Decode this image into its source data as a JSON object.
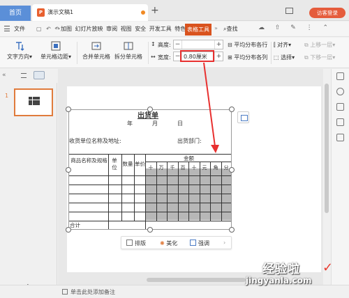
{
  "titlebar": {
    "home_tab": "首页",
    "doc_tab": "演示文稿1",
    "new_tab": "+",
    "guest_login": "访客登录"
  },
  "menubar": {
    "file": "文件",
    "items": [
      "加图",
      "幻灯片放映",
      "审阅",
      "视图",
      "安全",
      "开发工具",
      "特色功能"
    ],
    "active": "表格工具",
    "search": "查找"
  },
  "ribbon": {
    "text_direction": "文字方向",
    "cell_margin": "单元格边距",
    "merge_cells": "合并单元格",
    "split_cells": "拆分单元格",
    "height_label": "高度:",
    "height_value": "",
    "width_label": "宽度:",
    "width_value": "0.80厘米",
    "distribute_rows": "平均分布各行",
    "distribute_cols": "平均分布各列",
    "align": "对齐",
    "select": "选择",
    "move_up": "上移一层",
    "move_down": "下移一层",
    "minus": "−",
    "plus": "+"
  },
  "thumbnails": {
    "slide_number": "1",
    "add_slide": "+"
  },
  "document": {
    "title": "出货单",
    "date_year": "年",
    "date_month": "月",
    "date_day": "日",
    "recipient_address": "收货单位名称及地址:",
    "shipping_dept": "出货部门:",
    "header_product": "商品名称及规格",
    "header_unit": "单位",
    "header_qty": "数量",
    "header_price": "单价",
    "header_amount": "金额",
    "amount_digits": [
      "十",
      "万",
      "千",
      "百",
      "十",
      "元",
      "角",
      "分"
    ],
    "total_label": "合计"
  },
  "floatbar": {
    "layout": "排版",
    "beautify": "美化",
    "emphasize": "强调"
  },
  "statusbar": {
    "note_placeholder": "单击此处添加备注"
  },
  "watermark": {
    "text": "经验啦",
    "url": "jingyanla.com"
  },
  "colors": {
    "accent_orange": "#d9531e",
    "home_tab_blue": "#5b8fd8",
    "highlight_red": "#e8302f",
    "table_gray": "#b7b7b7"
  }
}
